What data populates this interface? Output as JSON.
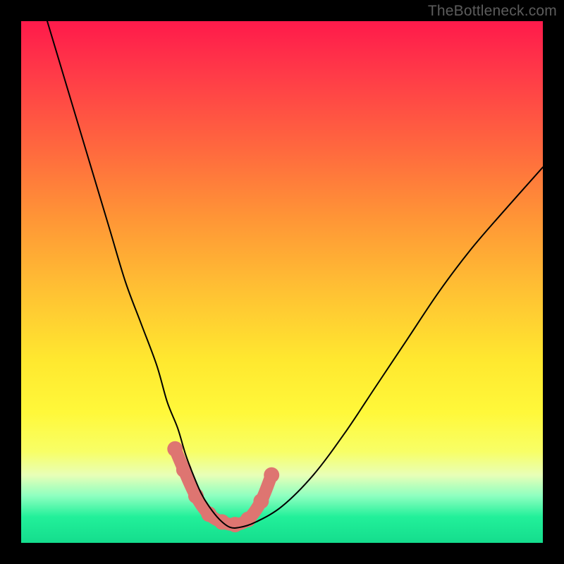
{
  "watermark": {
    "text": "TheBottleneck.com"
  },
  "chart_data": {
    "type": "line",
    "title": "",
    "xlabel": "",
    "ylabel": "",
    "xlim": [
      0,
      100
    ],
    "ylim": [
      0,
      100
    ],
    "grid": false,
    "legend": false,
    "series": [
      {
        "name": "bottleneck-curve",
        "x": [
          5,
          8,
          11,
          14,
          17,
          20,
          23,
          26,
          28,
          30,
          31.5,
          33,
          34.5,
          36,
          38,
          40,
          42,
          45,
          50,
          56,
          62,
          68,
          74,
          80,
          86,
          92,
          100
        ],
        "y": [
          100,
          90,
          80,
          70,
          60,
          50,
          42,
          34,
          27,
          22,
          17,
          13,
          9.5,
          7,
          4.5,
          3,
          3,
          4,
          7,
          13,
          21,
          30,
          39,
          48,
          56,
          63,
          72
        ]
      }
    ],
    "markers": {
      "name": "optimal-zone",
      "x": [
        29.5,
        31.2,
        33.5,
        36,
        38.5,
        41,
        43.5,
        46,
        48
      ],
      "y": [
        18,
        14,
        9,
        5.5,
        4,
        3.5,
        4.5,
        8,
        13
      ]
    }
  }
}
